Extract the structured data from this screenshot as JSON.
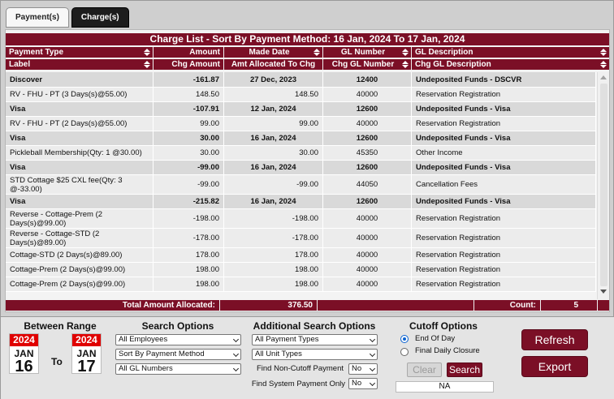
{
  "tabs": [
    {
      "label": "Payment(s)",
      "active": false
    },
    {
      "label": "Charge(s)",
      "active": true
    }
  ],
  "title": "Charge List - Sort By Payment Method: 16 Jan, 2024 To 17 Jan, 2024",
  "header1": {
    "payment_type": "Payment Type",
    "amount": "Amount",
    "made_date": "Made Date",
    "gl_number": "GL Number",
    "gl_description": "GL Description"
  },
  "header2": {
    "label": "Label",
    "chg_amount": "Chg Amount",
    "amt_allocated": "Amt Allocated To Chg",
    "chg_gl_number": "Chg GL Number",
    "chg_gl_description": "Chg GL Description"
  },
  "rows": [
    {
      "bold": true,
      "c1": "Discover",
      "c2": "-161.87",
      "c3": "27 Dec, 2023",
      "c4": "12400",
      "c5": "Undeposited Funds - DSCVR"
    },
    {
      "bold": false,
      "c1": "RV - FHU - PT (3 Days(s)@55.00)",
      "c2": "148.50",
      "c3": "148.50",
      "c4": "40000",
      "c5": "Reservation Registration"
    },
    {
      "bold": true,
      "c1": "Visa",
      "c2": "-107.91",
      "c3": "12 Jan, 2024",
      "c4": "12600",
      "c5": "Undeposited Funds - Visa"
    },
    {
      "bold": false,
      "c1": "RV - FHU - PT (2 Days(s)@55.00)",
      "c2": "99.00",
      "c3": "99.00",
      "c4": "40000",
      "c5": "Reservation Registration"
    },
    {
      "bold": true,
      "c1": "Visa",
      "c2": "30.00",
      "c3": "16 Jan, 2024",
      "c4": "12600",
      "c5": "Undeposited Funds - Visa"
    },
    {
      "bold": false,
      "c1": "Pickleball Membership(Qty: 1 @30.00)",
      "c2": "30.00",
      "c3": "30.00",
      "c4": "45350",
      "c5": "Other Income"
    },
    {
      "bold": true,
      "c1": "Visa",
      "c2": "-99.00",
      "c3": "16 Jan, 2024",
      "c4": "12600",
      "c5": "Undeposited Funds - Visa"
    },
    {
      "bold": false,
      "c1": "STD Cottage $25 CXL fee(Qty: 3 @-33.00)",
      "c2": "-99.00",
      "c3": "-99.00",
      "c4": "44050",
      "c5": "Cancellation Fees"
    },
    {
      "bold": true,
      "c1": "Visa",
      "c2": "-215.82",
      "c3": "16 Jan, 2024",
      "c4": "12600",
      "c5": "Undeposited Funds - Visa"
    },
    {
      "bold": false,
      "c1": "Reverse - Cottage-Prem (2 Days(s)@99.00)",
      "c2": "-198.00",
      "c3": "-198.00",
      "c4": "40000",
      "c5": "Reservation Registration"
    },
    {
      "bold": false,
      "c1": "Reverse - Cottage-STD (2 Days(s)@89.00)",
      "c2": "-178.00",
      "c3": "-178.00",
      "c4": "40000",
      "c5": "Reservation Registration"
    },
    {
      "bold": false,
      "c1": "Cottage-STD (2 Days(s)@89.00)",
      "c2": "178.00",
      "c3": "178.00",
      "c4": "40000",
      "c5": "Reservation Registration"
    },
    {
      "bold": false,
      "c1": "Cottage-Prem (2 Days(s)@99.00)",
      "c2": "198.00",
      "c3": "198.00",
      "c4": "40000",
      "c5": "Reservation Registration"
    },
    {
      "bold": false,
      "c1": "Cottage-Prem (2 Days(s)@99.00)",
      "c2": "198.00",
      "c3": "198.00",
      "c4": "40000",
      "c5": "Reservation Registration"
    }
  ],
  "totals": {
    "label": "Total Amount Allocated:",
    "value": "376.50",
    "count_label": "Count:",
    "count_value": "5"
  },
  "range": {
    "title": "Between Range",
    "from": {
      "year": "2024",
      "month": "JAN",
      "day": "16"
    },
    "to_label": "To",
    "to": {
      "year": "2024",
      "month": "JAN",
      "day": "17"
    }
  },
  "search_options": {
    "title": "Search Options",
    "employees": "All Employees",
    "sort": "Sort By Payment Method",
    "gl_numbers": "All GL Numbers"
  },
  "additional_options": {
    "title": "Additional Search Options",
    "payment_types": "All Payment Types",
    "unit_types": "All Unit Types",
    "non_cutoff_label": "Find Non-Cutoff Payment",
    "non_cutoff_value": "No",
    "system_payment_label": "Find System Payment Only",
    "system_payment_value": "No"
  },
  "cutoff": {
    "title": "Cutoff Options",
    "opt1": "End Of Day",
    "opt2": "Final Daily Closure",
    "clear": "Clear",
    "search": "Search",
    "na": "NA"
  },
  "actions": {
    "refresh": "Refresh",
    "export": "Export"
  },
  "colors": {
    "accent": "#7b0f26",
    "calendar_red": "#e00000"
  }
}
